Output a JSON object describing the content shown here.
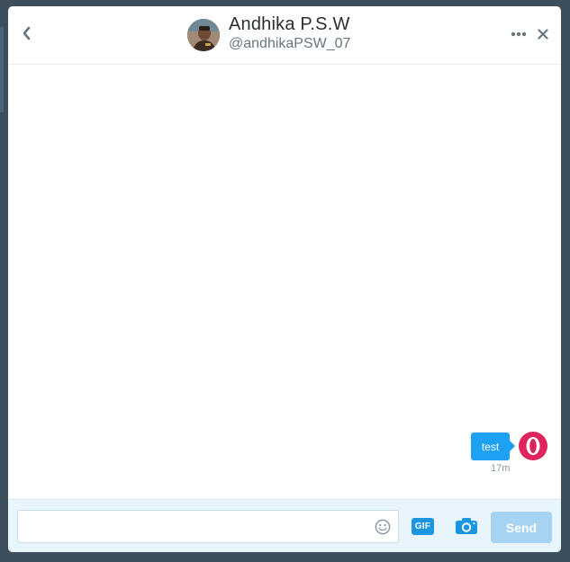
{
  "header": {
    "name": "Andhika P.S.W",
    "handle": "@andhikaPSW_07",
    "back_icon": "chevron-left-icon",
    "more_icon": "ellipsis-icon",
    "close_icon": "close-icon"
  },
  "conversation": {
    "messages": [
      {
        "text": "test",
        "time": "17m",
        "sender": "me"
      }
    ]
  },
  "composer": {
    "input_value": "",
    "emoji_icon": "emoji-icon",
    "gif_label": "GIF",
    "camera_icon": "camera-icon",
    "send_label": "Send"
  },
  "colors": {
    "accent": "#1da1f2",
    "send_disabled": "#a6d3f1",
    "composer_bg": "#e8f5fd",
    "my_avatar": "#e0245e"
  }
}
